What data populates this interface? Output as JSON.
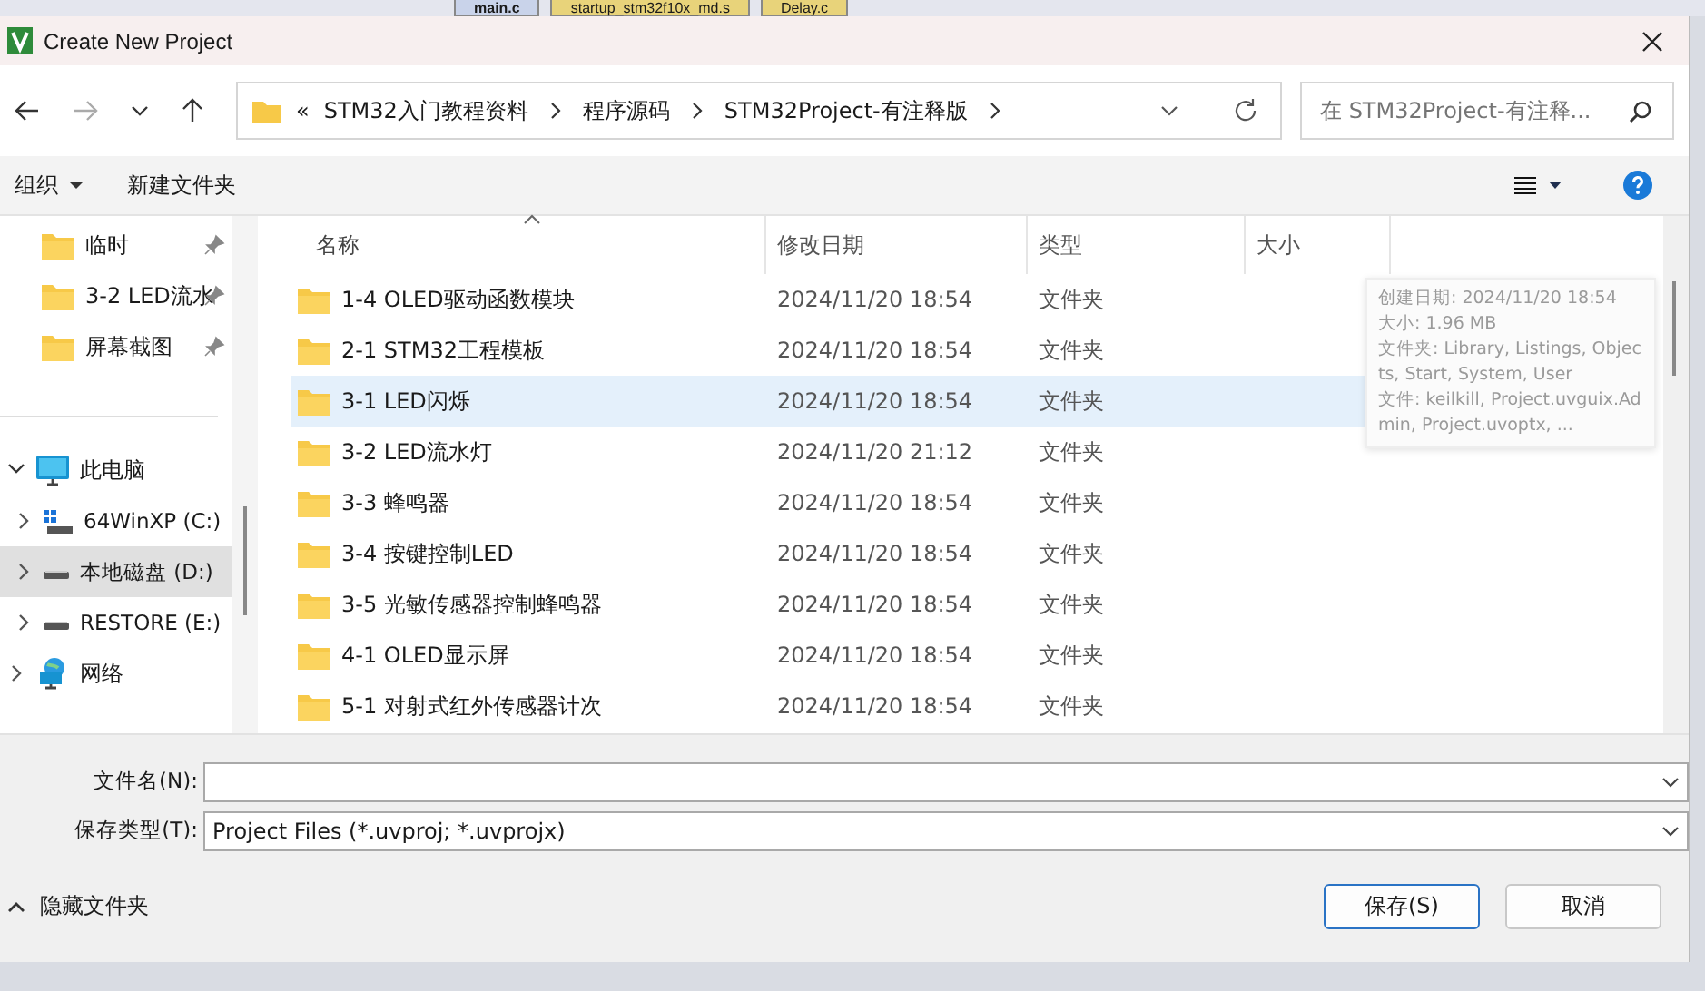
{
  "ide_tabs": [
    {
      "label": "main.c",
      "selected": true
    },
    {
      "label": "startup_stm32f10x_md.s",
      "selected": false
    },
    {
      "label": "Delay.c",
      "selected": false
    }
  ],
  "window": {
    "title": "Create New Project"
  },
  "address_bar": {
    "prefix": "«",
    "crumbs": [
      "STM32入门教程资料",
      "程序源码",
      "STM32Project-有注释版"
    ]
  },
  "search": {
    "placeholder": "在 STM32Project-有注释..."
  },
  "toolbar": {
    "organize": "组织",
    "new_folder": "新建文件夹"
  },
  "sidebar": {
    "items": [
      {
        "label": "临时",
        "kind": "folder",
        "pinned": true,
        "selected": false
      },
      {
        "label": "3-2 LED流水",
        "kind": "folder",
        "pinned": true,
        "selected": false
      },
      {
        "label": "屏幕截图",
        "kind": "folder",
        "pinned": true,
        "selected": false
      },
      {
        "label": "此电脑",
        "kind": "pc",
        "expanded": true,
        "selected": false,
        "children": [
          {
            "label": "64WinXP  (C:)",
            "kind": "windrive",
            "expanded": false,
            "selected": false
          },
          {
            "label": "本地磁盘 (D:)",
            "kind": "drive",
            "expanded": false,
            "selected": true
          },
          {
            "label": "RESTORE (E:)",
            "kind": "drive",
            "expanded": false,
            "selected": false
          }
        ]
      },
      {
        "label": "网络",
        "kind": "network",
        "expanded": false,
        "selected": false
      }
    ]
  },
  "table": {
    "columns": [
      {
        "label": "名称",
        "sorted": true
      },
      {
        "label": "修改日期",
        "sorted": false
      },
      {
        "label": "类型",
        "sorted": false
      },
      {
        "label": "大小",
        "sorted": false
      }
    ],
    "rows": [
      {
        "name": "1-4 OLED驱动函数模块",
        "date": "2024/11/20 18:54",
        "type": "文件夹",
        "selected": false
      },
      {
        "name": "2-1 STM32工程模板",
        "date": "2024/11/20 18:54",
        "type": "文件夹",
        "selected": false
      },
      {
        "name": "3-1 LED闪烁",
        "date": "2024/11/20 18:54",
        "type": "文件夹",
        "selected": true
      },
      {
        "name": "3-2 LED流水灯",
        "date": "2024/11/20 21:12",
        "type": "文件夹",
        "selected": false
      },
      {
        "name": "3-3 蜂鸣器",
        "date": "2024/11/20 18:54",
        "type": "文件夹",
        "selected": false
      },
      {
        "name": "3-4 按键控制LED",
        "date": "2024/11/20 18:54",
        "type": "文件夹",
        "selected": false
      },
      {
        "name": "3-5 光敏传感器控制蜂鸣器",
        "date": "2024/11/20 18:54",
        "type": "文件夹",
        "selected": false
      },
      {
        "name": "4-1 OLED显示屏",
        "date": "2024/11/20 18:54",
        "type": "文件夹",
        "selected": false
      },
      {
        "name": "5-1 对射式红外传感器计次",
        "date": "2024/11/20 18:54",
        "type": "文件夹",
        "selected": false
      }
    ]
  },
  "tooltip": {
    "lines": [
      "创建日期: 2024/11/20 18:54",
      "大小: 1.96 MB",
      "文件夹: Library, Listings, Objects, Start, System, User",
      "文件: keilkill, Project.uvguix.Admin, Project.uvoptx, ..."
    ]
  },
  "footer": {
    "filename_label": "文件名(N):",
    "filetype_label": "保存类型(T):",
    "filetype_value": "Project Files (*.uvproj; *.uvprojx)",
    "hide_folders": "隐藏文件夹",
    "buttons": [
      {
        "label": "保存(S)",
        "kind": "primary"
      },
      {
        "label": "取消",
        "kind": "normal"
      }
    ]
  }
}
